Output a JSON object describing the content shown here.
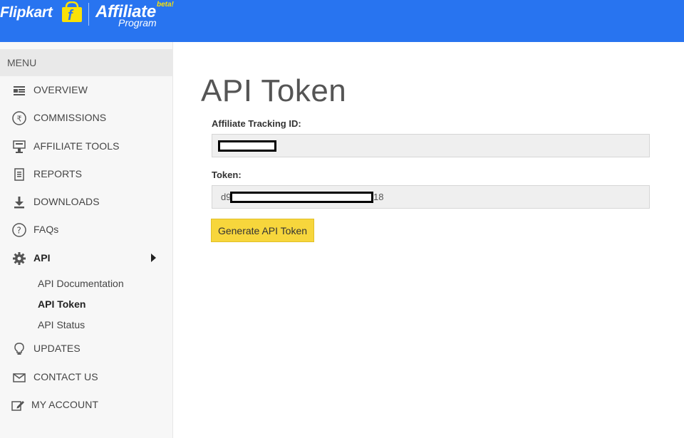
{
  "header": {
    "brand": "Flipkart",
    "affiliate_title": "Affiliate",
    "affiliate_program": "Program",
    "beta": "beta!",
    "brand_color": "#2874f0",
    "bag_color": "#f9e107"
  },
  "sidebar": {
    "menu_title": "MENU",
    "items": [
      {
        "label": "OVERVIEW",
        "icon": "overview-icon"
      },
      {
        "label": "COMMISSIONS",
        "icon": "rupee-icon"
      },
      {
        "label": "AFFILIATE TOOLS",
        "icon": "tools-icon"
      },
      {
        "label": "REPORTS",
        "icon": "reports-icon"
      },
      {
        "label": "DOWNLOADS",
        "icon": "download-icon"
      },
      {
        "label": "FAQs",
        "icon": "question-icon"
      },
      {
        "label": "API",
        "icon": "gear-icon",
        "expanded": true
      },
      {
        "label": "UPDATES",
        "icon": "bulb-icon"
      },
      {
        "label": "CONTACT US",
        "icon": "envelope-icon"
      },
      {
        "label": "MY ACCOUNT",
        "icon": "edit-icon"
      }
    ],
    "api_subitems": [
      {
        "label": "API Documentation"
      },
      {
        "label": "API Token",
        "active": true
      },
      {
        "label": "API Status"
      }
    ]
  },
  "main": {
    "title": "API Token",
    "tracking_label": "Affiliate Tracking ID:",
    "tracking_value": "",
    "token_label": "Token:",
    "token_prefix": "d9",
    "token_suffix": "18",
    "generate_button": "Generate API Token",
    "button_color": "#f7d63c"
  }
}
